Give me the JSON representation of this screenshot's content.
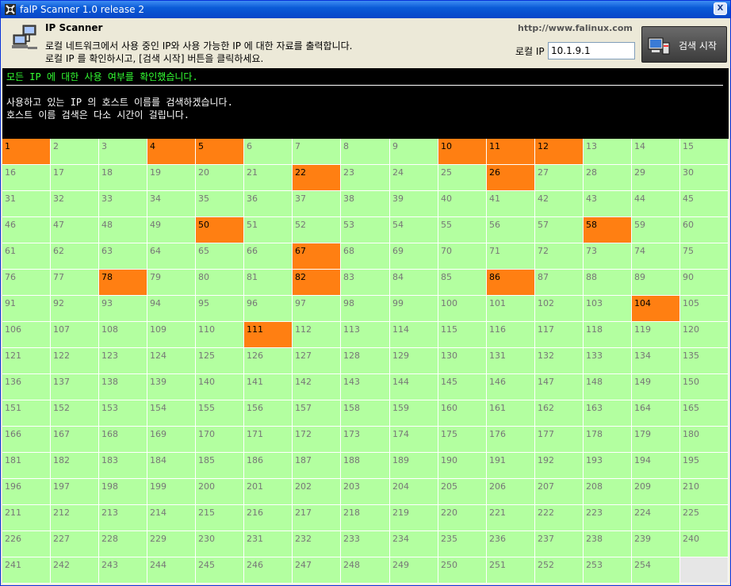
{
  "window": {
    "title": "falP Scanner 1.0 release 2",
    "close_label": "X"
  },
  "header": {
    "heading": "IP Scanner",
    "desc_line1": "로컬 네트워크에서 사용 중인 IP와 사용 가능한 IP 에 대한 자료를 출력합니다.",
    "desc_line2": "로컬 IP 를 확인하시고, [검색 시작] 버튼을 클릭하세요.",
    "url": "http://www.falinux.com",
    "local_ip_label": "로컬 IP",
    "local_ip_value": "10.1.9.1",
    "scan_button_label": "검색 시작"
  },
  "console": {
    "status_line": "모든 IP 에 대한 사용 여부를 확인했습니다.",
    "line1": "사용하고 있는 IP 의 호스트 이름를 검색하겠습니다.",
    "line2": "호스트 이름 검색은 다소 시간이 걸립니다."
  },
  "colors": {
    "used": "#ff7f12",
    "free": "#b3ffa0",
    "console_bg": "#000000",
    "status_text": "#33ff33"
  },
  "ip_grid": {
    "columns": 15,
    "first": 1,
    "last": 254,
    "used": [
      1,
      4,
      5,
      10,
      11,
      12,
      22,
      26,
      50,
      58,
      67,
      78,
      82,
      86,
      104,
      111
    ]
  }
}
